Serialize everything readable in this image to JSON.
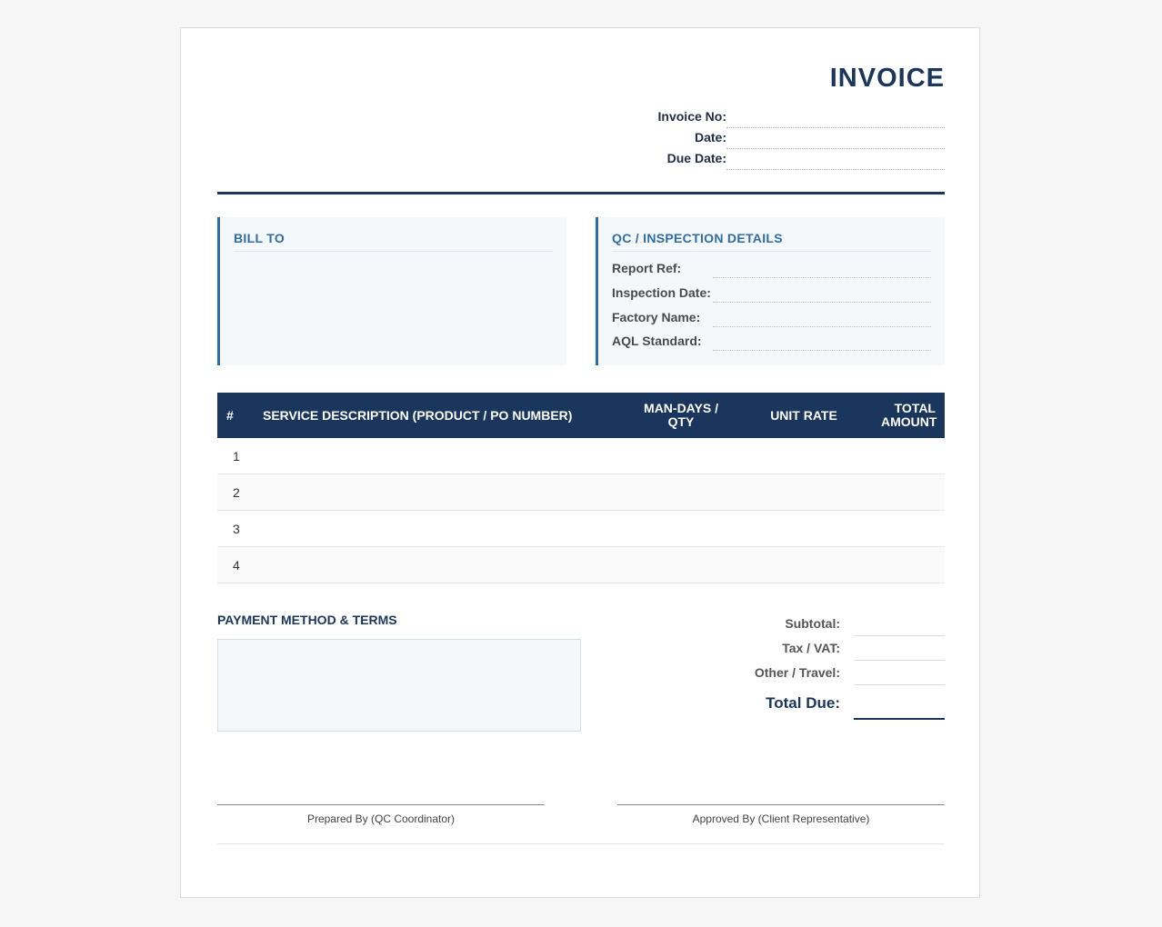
{
  "header": {
    "title": "INVOICE",
    "fields": [
      {
        "label": "Invoice No:",
        "value": ""
      },
      {
        "label": "Date:",
        "value": ""
      },
      {
        "label": "Due Date:",
        "value": ""
      }
    ]
  },
  "bill_to": {
    "heading": "BILL TO"
  },
  "qc": {
    "heading": "QC / INSPECTION DETAILS",
    "fields": [
      {
        "label": "Report Ref:",
        "value": ""
      },
      {
        "label": "Inspection Date:",
        "value": ""
      },
      {
        "label": "Factory Name:",
        "value": ""
      },
      {
        "label": "AQL Standard:",
        "value": ""
      }
    ]
  },
  "table": {
    "headers": [
      "#",
      "SERVICE DESCRIPTION (PRODUCT / PO NUMBER)",
      "MAN-DAYS / QTY",
      "UNIT RATE",
      "TOTAL AMOUNT"
    ],
    "rows": [
      {
        "num": "1"
      },
      {
        "num": "2"
      },
      {
        "num": "3"
      },
      {
        "num": "4"
      }
    ]
  },
  "payment": {
    "heading": "PAYMENT METHOD & TERMS"
  },
  "totals": {
    "subtotal_label": "Subtotal:",
    "tax_label": "Tax / VAT:",
    "other_label": "Other / Travel:",
    "due_label": "Total Due:"
  },
  "signatures": {
    "prepared": "Prepared By (QC Coordinator)",
    "approved": "Approved By (Client Representative)"
  },
  "colors": {
    "primary": "#1b365d",
    "accent": "#2e6da4",
    "panel": "#f4f8fb"
  }
}
